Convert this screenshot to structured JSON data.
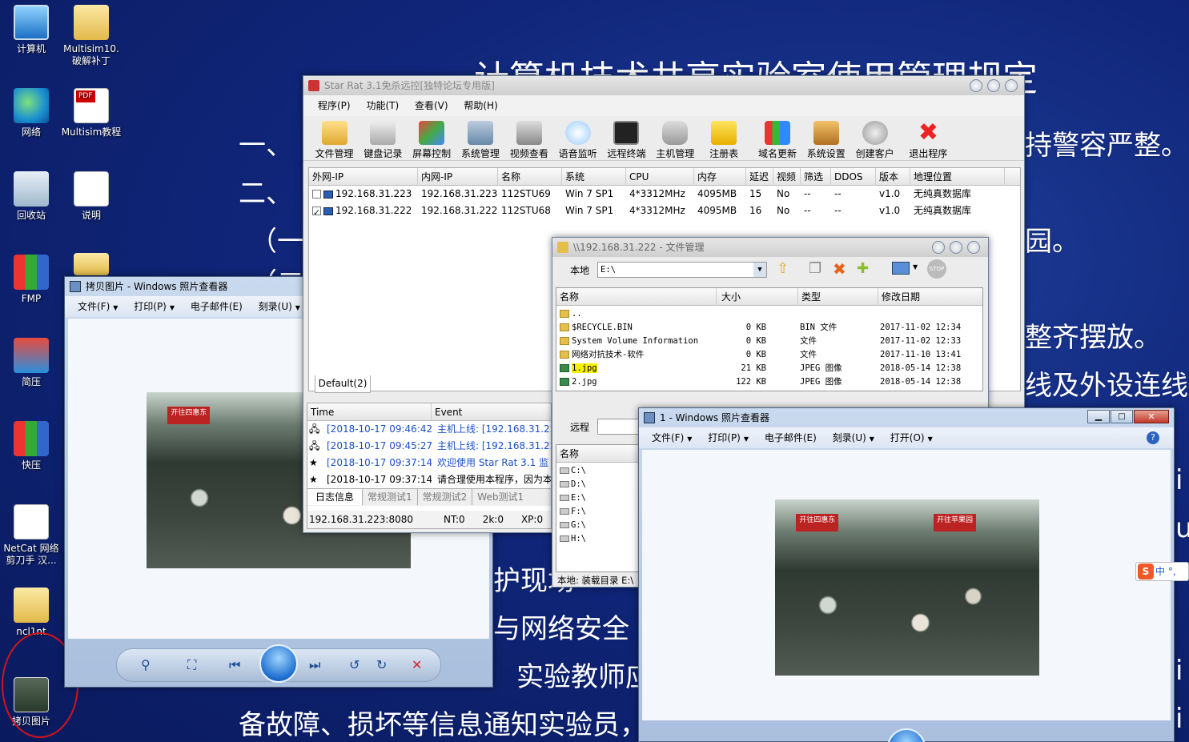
{
  "wallpaper": {
    "title": "计算机技术共享实验室使用管理规定",
    "lines": [
      "一、",
      "二、",
      "（一）",
      "（二）",
      "持警容严整。",
      "园。",
      "整齐摆放。",
      "线及外设连线，",
      "护现场",
      "与网络安全",
      "实验教师应",
      "备故障、损坏等信息通知实验员，",
      "i",
      "u",
      "i",
      "i"
    ]
  },
  "desktop_icons": [
    {
      "label": "计算机",
      "icon": "computer-icon"
    },
    {
      "label": "Multisim10.破解补丁",
      "icon": "folder-icon"
    },
    {
      "label": "网络",
      "icon": "network-icon"
    },
    {
      "label": "Multisim教程",
      "icon": "pdf-icon"
    },
    {
      "label": "回收站",
      "icon": "recycle-bin-icon"
    },
    {
      "label": "说明",
      "icon": "document-icon"
    },
    {
      "label": "FMP",
      "icon": "archive-icon"
    },
    {
      "label": "简压",
      "icon": "archive-icon"
    },
    {
      "label": "快压",
      "icon": "archive-icon"
    },
    {
      "label": "NetCat 网络剪刀手 汉...",
      "icon": "document-icon"
    },
    {
      "label": "ncl1nt",
      "icon": "folder-icon"
    },
    {
      "label": "拷贝图片",
      "icon": "image-icon"
    }
  ],
  "starrat": {
    "title": "Star Rat 3.1免杀远控[独特论坛专用版]",
    "menu": [
      "程序(P)",
      "功能(T)",
      "查看(V)",
      "帮助(H)"
    ],
    "toolbar": [
      "文件管理",
      "键盘记录",
      "屏幕控制",
      "系统管理",
      "视频查看",
      "语音监听",
      "远程终端",
      "主机管理",
      "注册表",
      "域名更新",
      "系统设置",
      "创建客户",
      "退出程序"
    ],
    "columns": [
      "外网-IP",
      "内网-IP",
      "名称",
      "系统",
      "CPU",
      "内存",
      "延迟",
      "视频",
      "筛选",
      "DDOS",
      "版本",
      "地理位置"
    ],
    "rows": [
      {
        "checked": false,
        "cells": [
          "192.168.31.223",
          "192.168.31.223",
          "112STU69",
          "Win 7 SP1",
          "4*3312MHz",
          "4095MB",
          "15",
          "No",
          "--",
          "--",
          "v1.0",
          "无纯真数据库"
        ]
      },
      {
        "checked": true,
        "cells": [
          "192.168.31.222",
          "192.168.31.222",
          "112STU68",
          "Win 7 SP1",
          "4*3312MHz",
          "4095MB",
          "16",
          "No",
          "--",
          "--",
          "v1.0",
          "无纯真数据库"
        ]
      }
    ],
    "group_tab": "Default(2)",
    "log_columns": [
      "Time",
      "Event"
    ],
    "log_rows": [
      {
        "time": "[2018-10-17 09:46:42]",
        "event": "主机上线: [192.168.31.222",
        "color": "#1a4fc9"
      },
      {
        "time": "[2018-10-17 09:45:27]",
        "event": "主机上线: [192.168.31.223",
        "color": "#1a4fc9"
      },
      {
        "time": "[2018-10-17 09:37:14]",
        "event": "欢迎使用 Star Rat 3.1  监",
        "color": "#1a4fc9"
      },
      {
        "time": "[2018-10-17 09:37:14]",
        "event": "请合理使用本程序，因为本",
        "color": "#000000"
      }
    ],
    "log_tabs": [
      "日志信息",
      "常规测试1",
      "常规测试2",
      "Web测试1"
    ],
    "status": [
      "192.168.31.223:8080",
      "NT:0",
      "2k:0",
      "XP:0"
    ]
  },
  "filemgr": {
    "title": "\\\\192.168.31.222 - 文件管理",
    "local_label": "本地",
    "path": "E:\\",
    "columns": [
      "名称",
      "大小",
      "类型",
      "修改日期"
    ],
    "files": [
      {
        "name": "..",
        "size": "",
        "type": "",
        "date": "",
        "kind": "up"
      },
      {
        "name": "$RECYCLE.BIN",
        "size": "0 KB",
        "type": "BIN 文件",
        "date": "2017-11-02 12:34",
        "kind": "folder"
      },
      {
        "name": "System Volume Information",
        "size": "0 KB",
        "type": "文件",
        "date": "2017-11-02 12:33",
        "kind": "folder"
      },
      {
        "name": "网络对抗技术-软件",
        "size": "0 KB",
        "type": "文件",
        "date": "2017-11-10 13:41",
        "kind": "folder"
      },
      {
        "name": "1.jpg",
        "size": "21 KB",
        "type": "JPEG 图像",
        "date": "2018-05-14 12:38",
        "kind": "image"
      },
      {
        "name": "2.jpg",
        "size": "122 KB",
        "type": "JPEG 图像",
        "date": "2018-05-14 12:38",
        "kind": "image"
      }
    ],
    "remote_label": "远程",
    "remote_col": "名称",
    "drives": [
      "C:\\",
      "D:\\",
      "E:\\",
      "F:\\",
      "G:\\",
      "H:\\"
    ],
    "status": "本地: 装载目录 E:\\"
  },
  "viewer_left": {
    "title": "拷贝图片 - Windows 照片查看器",
    "menu": [
      "文件(F)",
      "打印(P)",
      "电子邮件(E)",
      "刻录(U)"
    ]
  },
  "viewer_right": {
    "title": "1 - Windows 照片查看器",
    "menu": [
      "文件(F)",
      "打印(P)",
      "电子邮件(E)",
      "刻录(U)",
      "打开(O)"
    ]
  },
  "photo_signs": [
    "开往四惠东",
    "开往苹果园"
  ],
  "ime": "中",
  "colors": {
    "highlight": "#f6f000",
    "annotation": "#d4141a",
    "link": "#1a4fc9"
  }
}
